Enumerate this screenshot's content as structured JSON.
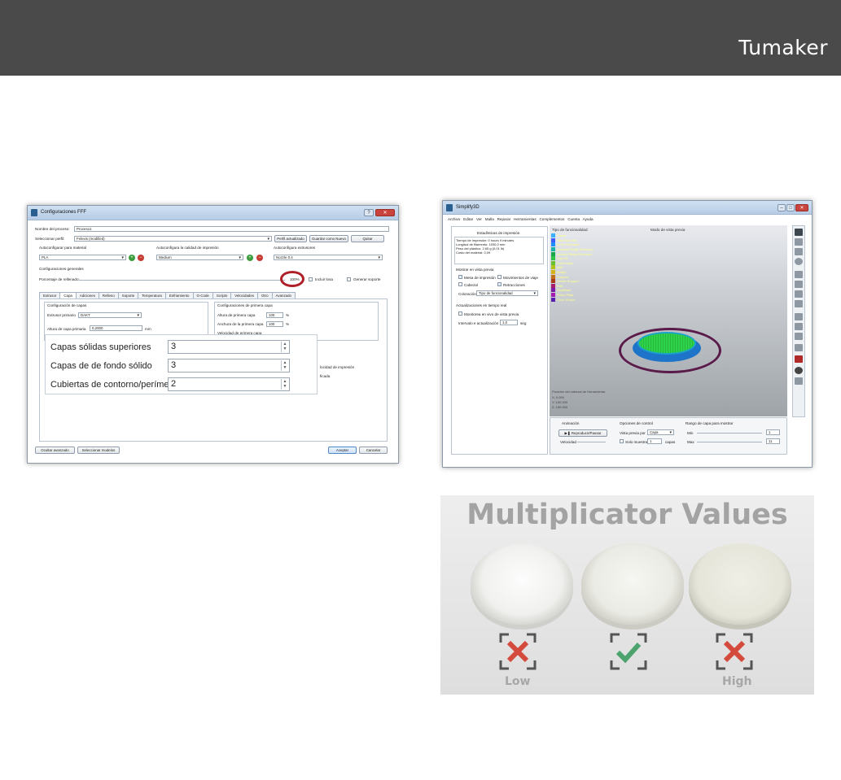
{
  "brand": {
    "logo": "Tumaker"
  },
  "fff": {
    "title": "Configuraciones FFF",
    "process_label": "Nombre del proceso:",
    "process_value": "Proceso1",
    "profile_label": "Seleccionar perfil:",
    "profile_value": "Felexis (modified)",
    "btn_update": "Perfil actualizado",
    "btn_save_new": "Guardar como Nuevo",
    "btn_remove": "Quitar",
    "auto_material": "Autoconfigurar para material",
    "material_value": "PLA",
    "auto_quality": "Autoconfigura la calidad de impresión",
    "quality_value": "Medium",
    "auto_extruder": "Autoconfigura extrusores",
    "extruder_value": "Nozzle 0.4",
    "general": "Configuraciones generales",
    "infill_label": "Porcentaje de rellenado:",
    "infill_value": "100%",
    "raft": "Incluir losa",
    "support": "Generar soporte",
    "tabs": [
      "Extrusor",
      "Capa",
      "Adiciones",
      "Relleno",
      "Soporte",
      "Temperatura",
      "Enfriamiento",
      "G-Code",
      "Scripts",
      "Velocidades",
      "Otro",
      "Avanzado"
    ],
    "layer_group": "Configuración de capas",
    "primary_extruder": "Extrusor primario",
    "primary_extruder_value": "DAKT",
    "layer_height": "Altura de capa primaria",
    "layer_height_value": "0,2000",
    "unit_mm": "mm",
    "first_layer_group": "Configuraciones de primera capa",
    "first_height": "Altura de primera capa",
    "first_height_value": "100",
    "first_width": "Anchura de la primera capa",
    "first_width_value": "100",
    "first_speed": "Velocidad de primera capa",
    "pct": "%",
    "zoom": {
      "top": "Capas sólidas superiores",
      "top_value": "3",
      "bottom": "Capas de de fondo sólido",
      "bottom_value": "3",
      "outline": "Cubiertas de contorno/perímetro",
      "outline_value": "2"
    },
    "right_fragment": "locidad de impresión",
    "right_fragment2": "ficada",
    "btn_hide": "Ocultar avanzado",
    "btn_select": "Seleccionar modelos",
    "btn_ok": "Aceptar",
    "btn_cancel": "Cancelar"
  },
  "s3d": {
    "title": "Simplify3D",
    "menu": [
      "Archivo",
      "Editar",
      "Ver",
      "Malla",
      "Reparar",
      "Herramientas",
      "Complementos",
      "Cuenta",
      "Ayuda"
    ],
    "stats_title": "Estadísticas de impresión",
    "stats": [
      "Tiempo de impresión: 0 hours 9 minutes",
      "Longitud de filamento: 1030,0 mm",
      "Peso del plástico: 2,65 g (0,01 lb)",
      "Costo del material: 0,09"
    ],
    "preview_title": "Mostrar en vista previa",
    "opt_moves": "Mesa de impresión",
    "opt_travel": "Movimientos de viaje",
    "opt_head": "Cabezal",
    "opt_retract": "Retracciones",
    "coloring": "Coloración",
    "coloring_value": "Tipo de funcionalidad",
    "realtime": "Actualizaciones en tiempo real",
    "live": "Monitorea en vivo de vista previa",
    "interval": "Intervalo e actualización",
    "interval_value": "1,0",
    "interval_unit": "seg",
    "feature_type": "Tipo de funcionalidad",
    "preview_mode": "Modo de vista previa",
    "legend": [
      {
        "name": "Travel",
        "color": "#3ab0ff"
      },
      {
        "name": "Skin/Top Infill",
        "color": "#3b5bff"
      },
      {
        "name": "Inner Perimeter",
        "color": "#1f8fff"
      },
      {
        "name": "External Single Extrusion",
        "color": "#17b3a3"
      },
      {
        "name": "Internal Single Extrusion",
        "color": "#1aa64b"
      },
      {
        "name": "Gap Fill",
        "color": "#2ec246"
      },
      {
        "name": "Solid Layer",
        "color": "#69c22e"
      },
      {
        "name": "Infill",
        "color": "#b0c21b"
      },
      {
        "name": "Bridge",
        "color": "#d4b21a"
      },
      {
        "name": "Support",
        "color": "#c26f1a"
      },
      {
        "name": "Dense Support",
        "color": "#a83d1c"
      },
      {
        "name": "Raft",
        "color": "#a81c6b"
      },
      {
        "name": "Skirt/Brim",
        "color": "#7a1ca8"
      },
      {
        "name": "Prime Pillar",
        "color": "#a31cb0"
      },
      {
        "name": "Ooze Shield",
        "color": "#5a1fb0"
      }
    ],
    "position_title": "Posición del cabezal de Herramienta",
    "position": [
      "X: 0.000",
      "Y: 150.000",
      "Z: 150.000"
    ],
    "anim": "Animación",
    "play": "Reproducir/Pausar",
    "speed": "Velocidad",
    "ctrl": "Opciones de control",
    "view_by": "Vista previa por",
    "view_by_value": "Capa",
    "only_show": "Solo muestra",
    "only_show_value": "1",
    "layers": "capas",
    "range": "Rango de capa para mostrar",
    "min": "Min",
    "min_value": "1",
    "max": "Max",
    "max_value": "11"
  },
  "photo": {
    "title": "Multiplicator Values",
    "low": "Low",
    "high": "High"
  }
}
